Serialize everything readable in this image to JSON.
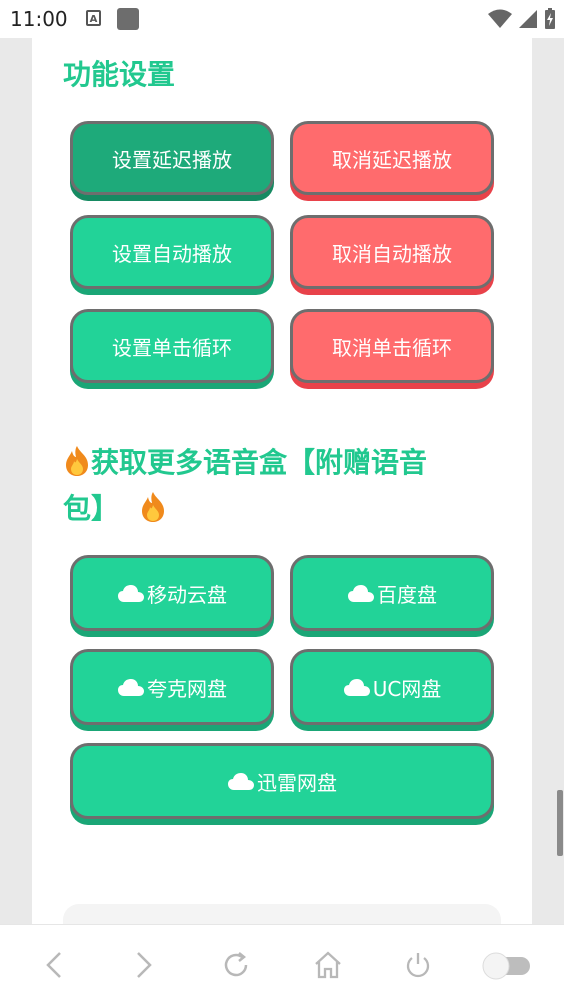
{
  "status_bar": {
    "time": "11:00"
  },
  "settings_section": {
    "title": "功能设置",
    "buttons": [
      {
        "label": "设置延迟播放"
      },
      {
        "label": "取消延迟播放"
      },
      {
        "label": "设置自动播放"
      },
      {
        "label": "取消自动播放"
      },
      {
        "label": "设置单击循环"
      },
      {
        "label": "取消单击循环"
      }
    ]
  },
  "download_section": {
    "title_line1": "获取更多语音盒【附赠语音",
    "title_line2": "包】",
    "buttons": [
      {
        "label": "移动云盘"
      },
      {
        "label": "百度盘"
      },
      {
        "label": "夸克网盘"
      },
      {
        "label": "UC网盘"
      },
      {
        "label": "迅雷网盘"
      }
    ]
  },
  "colors": {
    "accent_green": "#22d398",
    "title_green": "#22c88f",
    "cancel_red": "#ff6b6d"
  }
}
